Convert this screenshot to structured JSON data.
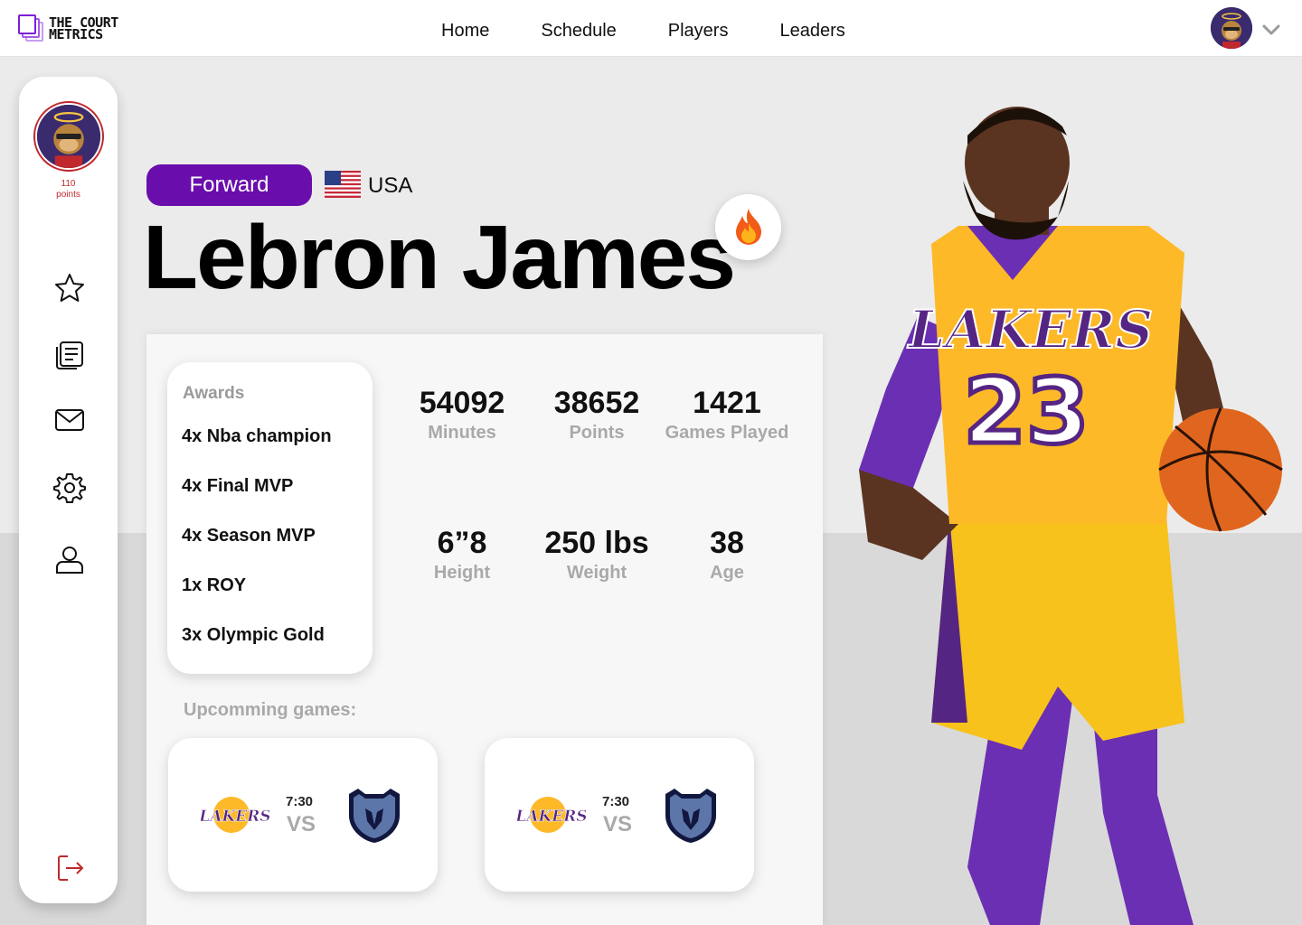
{
  "brand": {
    "line1": "THE COURT",
    "line2": "METRICS"
  },
  "nav": {
    "items": [
      "Home",
      "Schedule",
      "Players",
      "Leaders"
    ]
  },
  "sidebar": {
    "points_value": "110",
    "points_label": "points"
  },
  "player": {
    "position": "Forward",
    "country": "USA",
    "name": "Lebron James",
    "jersey_number": "23",
    "team_wordmark": "LAKERS"
  },
  "awards": {
    "title": "Awards",
    "items": [
      "4x Nba champion",
      "4x Final MVP",
      "4x Season MVP",
      "1x ROY",
      "3x Olympic Gold"
    ]
  },
  "stats": [
    {
      "value": "54092",
      "label": "Minutes"
    },
    {
      "value": "38652",
      "label": "Points"
    },
    {
      "value": "1421",
      "label": "Games Played"
    },
    {
      "value": "6”8",
      "label": "Height"
    },
    {
      "value": "250 lbs",
      "label": "Weight"
    },
    {
      "value": "38",
      "label": "Age"
    }
  ],
  "upcoming": {
    "title": "Upcomming games:",
    "games": [
      {
        "time": "7:30",
        "vs": "VS",
        "home_logo_text": "LAKERS"
      },
      {
        "time": "7:30",
        "vs": "VS",
        "home_logo_text": "LAKERS"
      }
    ]
  },
  "colors": {
    "accent": "#6a0dad",
    "alert": "#c0282d",
    "lakers_gold": "#fdb927",
    "lakers_purple": "#552583",
    "grizzlies_navy": "#12173f"
  },
  "icons": [
    "star-icon",
    "news-icon",
    "mail-icon",
    "settings-icon",
    "profile-icon",
    "logout-icon",
    "fire-icon",
    "chevron-down-icon"
  ]
}
